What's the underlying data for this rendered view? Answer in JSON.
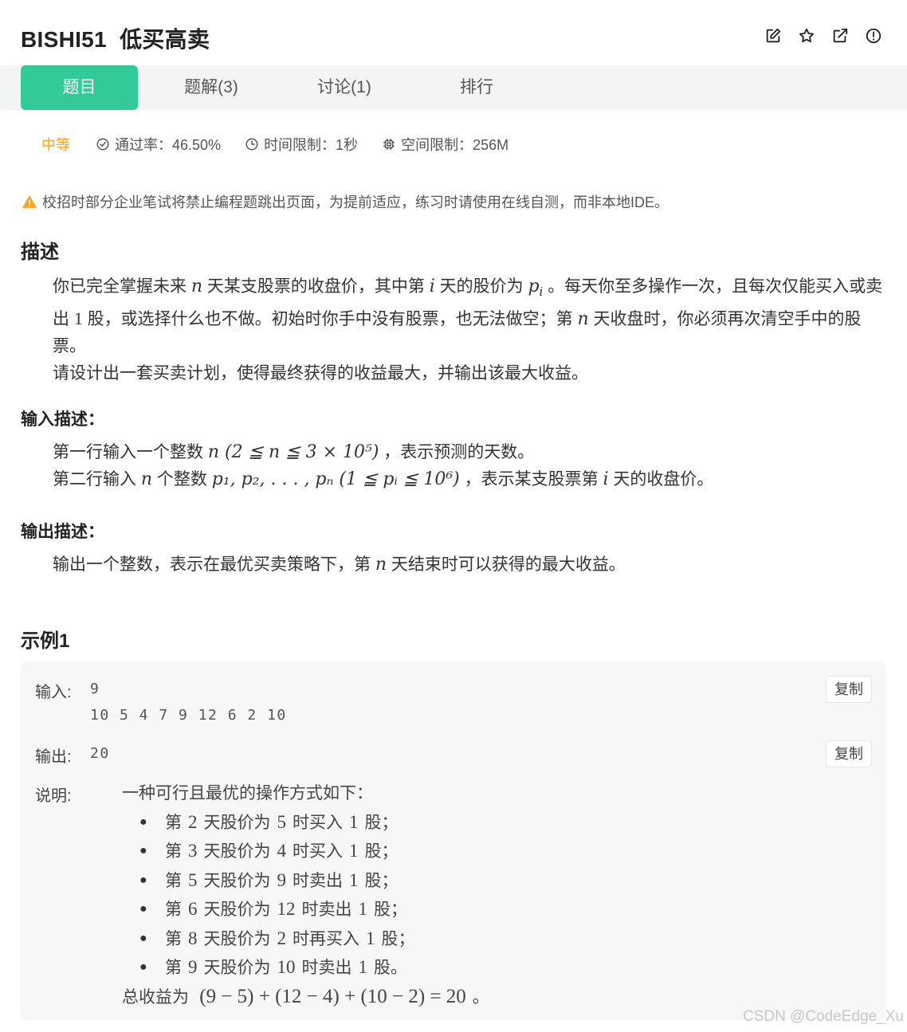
{
  "header": {
    "title": "BISHI51  低买高卖",
    "icons": [
      "edit-icon",
      "star-icon",
      "external-link-icon",
      "info-circle-icon"
    ]
  },
  "tabs": [
    {
      "label": "题目",
      "active": true
    },
    {
      "label": "题解(3)",
      "active": false
    },
    {
      "label": "讨论(1)",
      "active": false
    },
    {
      "label": "排行",
      "active": false
    }
  ],
  "meta": {
    "difficulty": "中等",
    "pass_rate": "通过率：46.50%",
    "time_limit": "时间限制：1秒",
    "memory_limit": "空间限制：256M"
  },
  "notice": "校招时部分企业笔试将禁止编程题跳出页面，为提前适应，练习时请使用在线自测，而非本地IDE。",
  "description": {
    "heading": "描述",
    "p1_a": "你已完全掌握未来",
    "p1_n": "n",
    "p1_b": "天某支股票的收盘价，其中第",
    "p1_i": "i",
    "p1_c": "天的股价为",
    "p1_p": "p",
    "p1_sub": "i",
    "p1_d": "。每天你至多操作一次，且每次仅能买入或卖出",
    "p1_one": "1",
    "p1_e": "股，或选择什么也不做。初始时你手中没有股票，也无法做空；第",
    "p1_n2": "n",
    "p1_f": "天收盘时，你必须再次清空手中的股票。",
    "p2": "请设计出一套买卖计划，使得最终获得的收益最大，并输出该最大收益。"
  },
  "input_desc": {
    "heading": "输入描述：",
    "l1_a": "第一行输入一个整数",
    "l1_math": "n (2 ≦ n ≦ 3 × 10⁵)",
    "l1_b": "，表示预测的天数。",
    "l2_a": "第二行输入",
    "l2_n": "n",
    "l2_b": "个整数",
    "l2_math": "p₁, p₂, . . . , pₙ (1 ≦ pᵢ ≦ 10⁶)",
    "l2_c": "，表示某支股票第",
    "l2_i": "i",
    "l2_d": "天的收盘价。"
  },
  "output_desc": {
    "heading": "输出描述：",
    "l1_a": "输出一个整数，表示在最优买卖策略下，第",
    "l1_n": "n",
    "l1_b": "天结束时可以获得的最大收益。"
  },
  "example": {
    "heading": "示例1",
    "input_label": "输入:",
    "input_line1": "9",
    "input_line2": "10 5 4 7 9 12 6 2 10",
    "output_label": "输出:",
    "output_value": "20",
    "copy_label": "复制",
    "explain_label": "说明:",
    "explain_intro": "一种可行且最优的操作方式如下：",
    "steps": [
      {
        "a": "第",
        "day": "2",
        "b": "天股价为",
        "price": "5",
        "c": "时买入",
        "qty": "1",
        "d": "股；"
      },
      {
        "a": "第",
        "day": "3",
        "b": "天股价为",
        "price": "4",
        "c": "时买入",
        "qty": "1",
        "d": "股；"
      },
      {
        "a": "第",
        "day": "5",
        "b": "天股价为",
        "price": "9",
        "c": "时卖出",
        "qty": "1",
        "d": "股；"
      },
      {
        "a": "第",
        "day": "6",
        "b": "天股价为",
        "price": "12",
        "c": "时卖出",
        "qty": "1",
        "d": "股；"
      },
      {
        "a": "第",
        "day": "8",
        "b": "天股价为",
        "price": "2",
        "c": "时再买入",
        "qty": "1",
        "d": "股；"
      },
      {
        "a": "第",
        "day": "9",
        "b": "天股价为",
        "price": "10",
        "c": "时卖出",
        "qty": "1",
        "d": "股。"
      }
    ],
    "total_label": "总收益为",
    "total_expr": "(9 − 5) + (12 − 4) + (10 − 2) = 20",
    "total_end": "。"
  },
  "watermark": "CSDN @CodeEdge_Xu",
  "colors": {
    "accent": "#32ca99",
    "difficulty": "#f5a623",
    "warning": "#f5a623"
  }
}
